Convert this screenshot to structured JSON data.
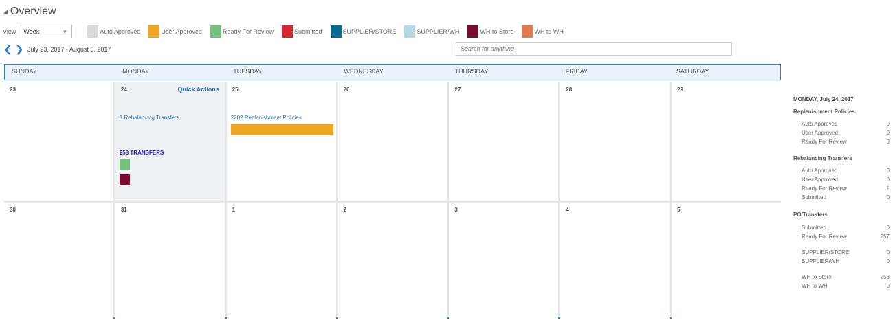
{
  "header": {
    "title": "Overview"
  },
  "view": {
    "label": "View",
    "value": "Week"
  },
  "legend": [
    {
      "label": "Auto Approved",
      "color": "#d9d9d9"
    },
    {
      "label": "User Approved",
      "color": "#eea521"
    },
    {
      "label": "Ready For Review",
      "color": "#74c07c"
    },
    {
      "label": "Submitted",
      "color": "#d6262f"
    },
    {
      "label": "SUPPLIER/STORE",
      "color": "#076a8e"
    },
    {
      "label": "SUPPLIER/WH",
      "color": "#b7d7e3"
    },
    {
      "label": "WH to Store",
      "color": "#7a0c2e"
    },
    {
      "label": "WH to WH",
      "color": "#e07a4f"
    }
  ],
  "nav": {
    "range": "July 23, 2017 - August 5, 2017"
  },
  "search": {
    "placeholder": "Search for anything"
  },
  "calendar": {
    "days": [
      "SUNDAY",
      "MONDAY",
      "TUESDAY",
      "WEDNESDAY",
      "THURSDAY",
      "FRIDAY",
      "SATURDAY"
    ],
    "week1": [
      "23",
      "24",
      "25",
      "26",
      "27",
      "28",
      "29"
    ],
    "week2": [
      "30",
      "31",
      "1",
      "2",
      "3",
      "4",
      "5"
    ],
    "quick_actions": "Quick Actions",
    "rebalancing_link": "1 Rebalancing Transfers",
    "replenishment_link": "2202 Replenishment Policies",
    "transfers_link": "258 TRANSFERS"
  },
  "side": {
    "date": "MONDAY, July 24, 2017",
    "replenishment": {
      "title": "Replenishment Policies",
      "rows": [
        {
          "label": "Auto Approved",
          "value": "0"
        },
        {
          "label": "User Approved",
          "value": "0"
        },
        {
          "label": "Ready For Review",
          "value": "0"
        }
      ]
    },
    "rebalancing": {
      "title": "Rebalancing Transfers",
      "rows": [
        {
          "label": "Auto Approved",
          "value": "0"
        },
        {
          "label": "User Approved",
          "value": "0"
        },
        {
          "label": "Ready For Review",
          "value": "1"
        },
        {
          "label": "Submitted",
          "value": "0"
        }
      ]
    },
    "po": {
      "title": "PO/Transfers",
      "rows_a": [
        {
          "label": "Submitted",
          "value": "0"
        },
        {
          "label": "Ready For Review",
          "value": "257"
        }
      ],
      "rows_b": [
        {
          "label": "SUPPLIER/STORE",
          "value": "0"
        },
        {
          "label": "SUPPLIER/WH",
          "value": "0"
        }
      ],
      "rows_c": [
        {
          "label": "WH to Store",
          "value": "258"
        },
        {
          "label": "WH to WH",
          "value": "0"
        }
      ]
    }
  }
}
